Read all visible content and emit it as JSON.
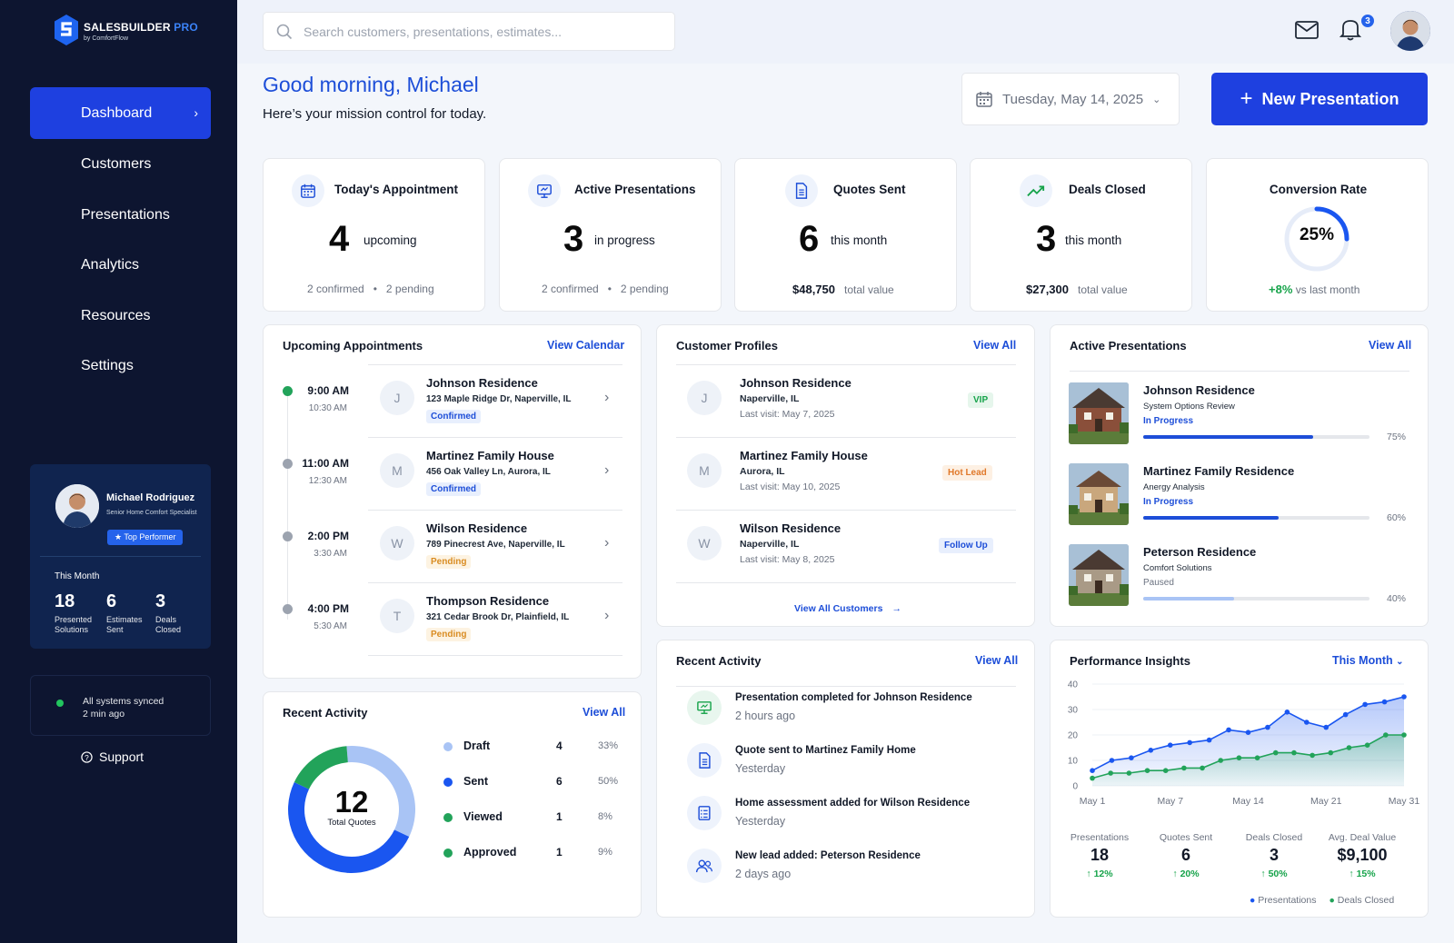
{
  "brand": {
    "name": "SALESBUILDER",
    "pro": "PRO",
    "sub": "by ComfortFlow"
  },
  "nav": [
    {
      "label": "Dashboard",
      "active": true
    },
    {
      "label": "Customers"
    },
    {
      "label": "Presentations"
    },
    {
      "label": "Analytics"
    },
    {
      "label": "Resources"
    },
    {
      "label": "Settings"
    }
  ],
  "profile": {
    "name": "Michael Rodriguez",
    "role": "Senior Home Comfort Specialist",
    "badge": "Top Performer",
    "month_label": "This Month",
    "stats": [
      {
        "value": "18",
        "label1": "Presented",
        "label2": "Solutions"
      },
      {
        "value": "6",
        "label1": "Estimates",
        "label2": "Sent"
      },
      {
        "value": "3",
        "label1": "Deals",
        "label2": "Closed"
      }
    ]
  },
  "sync": {
    "line1": "All systems synced",
    "line2": "2 min ago"
  },
  "support_label": "Support",
  "search": {
    "placeholder": "Search customers, presentations, estimates..."
  },
  "notifications": {
    "count": "3"
  },
  "greeting": {
    "title": "Good morning, Michael",
    "subtitle": "Here’s your mission control for today."
  },
  "date_selector": {
    "value": "Tuesday, May 14, 2025"
  },
  "new_presentation": {
    "label": "New Presentation"
  },
  "kpis": {
    "appointment": {
      "title": "Today's Appointment",
      "value": "4",
      "unit": "upcoming",
      "foot1": "2 confirmed",
      "foot2": "2 pending"
    },
    "active": {
      "title": "Active Presentations",
      "value": "3",
      "unit": "in progress",
      "foot1": "2 confirmed",
      "foot2": "2 pending"
    },
    "quotes": {
      "title": "Quotes Sent",
      "value": "6",
      "unit": "this month",
      "amount": "$48,750",
      "foot": "total value"
    },
    "deals": {
      "title": "Deals Closed",
      "value": "3",
      "unit": "this month",
      "amount": "$27,300",
      "foot": "total value"
    },
    "conversion": {
      "title": "Conversion Rate",
      "value": "25%",
      "percent": 25,
      "change": "+8%",
      "foot": "vs last month"
    }
  },
  "appointments": {
    "title": "Upcoming Appointments",
    "link": "View Calendar",
    "items": [
      {
        "time": "9:00 AM",
        "end": "10:30 AM",
        "initial": "J",
        "name": "Johnson Residence",
        "address": "123 Maple Ridge Dr, Naperville, IL",
        "status": "Confirmed",
        "dot": "#22a35a"
      },
      {
        "time": "11:00 AM",
        "end": "12:30 AM",
        "initial": "M",
        "name": "Martinez Family House",
        "address": "456 Oak Valley Ln, Aurora, IL",
        "status": "Confirmed",
        "dot": "#9ca3af"
      },
      {
        "time": "2:00 PM",
        "end": "3:30 AM",
        "initial": "W",
        "name": "Wilson Residence",
        "address": "789 Pinecrest Ave, Naperville, IL",
        "status": "Pending",
        "dot": "#9ca3af"
      },
      {
        "time": "4:00 PM",
        "end": "5:30 AM",
        "initial": "T",
        "name": "Thompson Residence",
        "address": "321 Cedar Brook Dr, Plainfield, IL",
        "status": "Pending",
        "dot": "#9ca3af"
      }
    ]
  },
  "customers": {
    "title": "Customer Profiles",
    "link": "View All",
    "footer_link": "View All Customers",
    "items": [
      {
        "initial": "J",
        "name": "Johnson Residence",
        "city": "Naperville, IL",
        "visit": "Last visit: May 7, 2025",
        "tag": "VIP",
        "tag_bg": "#e6f6ec",
        "tag_color": "#16a34a"
      },
      {
        "initial": "M",
        "name": "Martinez Family House",
        "city": "Aurora, IL",
        "visit": "Last visit: May 10, 2025",
        "tag": "Hot Lead",
        "tag_bg": "#fdf0e3",
        "tag_color": "#e0782a"
      },
      {
        "initial": "W",
        "name": "Wilson Residence",
        "city": "Naperville, IL",
        "visit": "Last visit: May 8, 2025",
        "tag": "Follow Up",
        "tag_bg": "#e8effd",
        "tag_color": "#1d4ed8"
      }
    ]
  },
  "active_presentations": {
    "title": "Active Presentations",
    "link": "View All",
    "items": [
      {
        "name": "Johnson Residence",
        "subtitle": "System Options Review",
        "status": "In Progress",
        "progress": 75,
        "pct": "75%",
        "color": "#1d4ed8"
      },
      {
        "name": "Martinez Family Residence",
        "subtitle": "Anergy Analysis",
        "status": "In Progress",
        "progress": 60,
        "pct": "60%",
        "color": "#1d4ed8"
      },
      {
        "name": "Peterson Residence",
        "subtitle": "Comfort Solutions",
        "status": "Paused",
        "progress": 40,
        "pct": "40%",
        "color": "#a9c4f5"
      }
    ]
  },
  "quotes_activity": {
    "title": "Recent Activity",
    "link": "View All",
    "total": "12",
    "total_label": "Total Quotes",
    "items": [
      {
        "name": "Draft",
        "count": "4",
        "pct": "33%",
        "color": "#a9c4f5",
        "value": 4
      },
      {
        "name": "Sent",
        "count": "6",
        "pct": "50%",
        "color": "#1a56f0",
        "value": 6
      },
      {
        "name": "Viewed",
        "count": "1",
        "pct": "8%",
        "color": "#22a35a",
        "value": 1
      },
      {
        "name": "Approved",
        "count": "1",
        "pct": "9%",
        "color": "#22a35a",
        "value": 1
      }
    ]
  },
  "recent_activity": {
    "title": "Recent Activity",
    "link": "View All",
    "items": [
      {
        "title": "Presentation completed for Johnson Residence",
        "time": "2 hours ago",
        "icon": "presentation-icon"
      },
      {
        "title": "Quote sent to Martinez Family Home",
        "time": "Yesterday",
        "icon": "document-icon"
      },
      {
        "title": "Home assessment added for Wilson Residence",
        "time": "Yesterday",
        "icon": "checklist-icon"
      },
      {
        "title": "New lead added: Peterson Residence",
        "time": "2 days ago",
        "icon": "users-icon"
      }
    ]
  },
  "performance": {
    "title": "Performance Insights",
    "range": "This Month",
    "stats": [
      {
        "label": "Presentations",
        "value": "18",
        "change": "↑ 12%"
      },
      {
        "label": "Quotes Sent",
        "value": "6",
        "change": "↑ 20%"
      },
      {
        "label": "Deals Closed",
        "value": "3",
        "change": "↑ 50%"
      },
      {
        "label": "Avg. Deal Value",
        "value": "$9,100",
        "change": "↑ 15%"
      }
    ],
    "legend": [
      "Presentations",
      "Deals Closed"
    ]
  },
  "chart_data": {
    "type": "area",
    "x": [
      "May 1",
      "May 2",
      "May 3",
      "May 5",
      "May 7",
      "May 8",
      "May 10",
      "May 12",
      "May 13",
      "May 14",
      "May 16",
      "May 18",
      "May 19",
      "May 21",
      "May 23",
      "May 25",
      "May 28",
      "May 31"
    ],
    "xticks": [
      "May 1",
      "May 7",
      "May 14",
      "May 21",
      "May 31"
    ],
    "yticks": [
      0,
      10,
      20,
      30,
      40
    ],
    "ylim": [
      0,
      40
    ],
    "series": [
      {
        "name": "Presentations",
        "color": "#1a56f0",
        "values": [
          6,
          10,
          11,
          14,
          16,
          17,
          18,
          22,
          21,
          23,
          29,
          25,
          23,
          28,
          32,
          33,
          35
        ]
      },
      {
        "name": "Deals Closed",
        "color": "#22a35a",
        "values": [
          3,
          5,
          5,
          6,
          6,
          7,
          7,
          10,
          11,
          11,
          13,
          13,
          12,
          13,
          15,
          16,
          20,
          20
        ]
      }
    ],
    "grid": true
  }
}
